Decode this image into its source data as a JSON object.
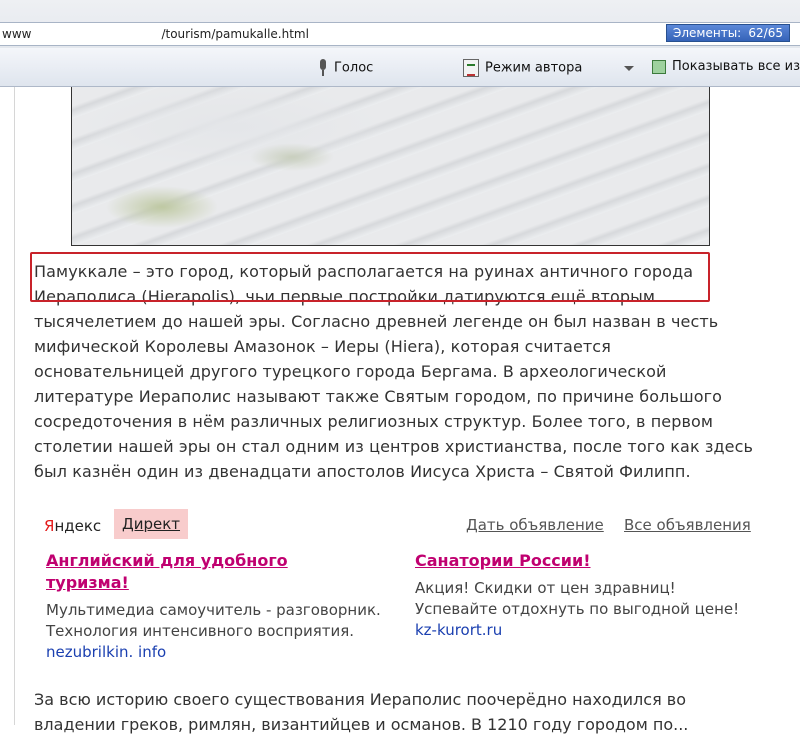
{
  "browser": {
    "url_prefix": "www",
    "url_path": "/tourism/pamukalle.html",
    "elements_label": "Элементы:",
    "elements_value": "62/65"
  },
  "toolbar": {
    "voice_label": "Голос",
    "author_mode_label": "Режим автора",
    "show_images_label": "Показывать все изоб"
  },
  "article": {
    "lines": [
      "Памуккале – это город, который располагается на руинах античного города",
      "Иераполиса (Hierapolis), чьи первые постройки датируются ещё вторым",
      "тысячелетием до нашей эры. Согласно древней легенде он был назван в честь",
      "мифической Королевы Амазонок – Иеры (Hiera), которая считается",
      "основательницей другого турецкого города Бергама. В археологической",
      "литературе Иераполис называют также Святым городом, по причине большого",
      "сосредоточения в нём различных религиозных структур. Более того, в первом",
      "столетии нашей эры он стал одним из центров христианства, после того как здесь",
      "был казнён один из двенадцати апостолов Иисуса Христа – Святой Филипп."
    ],
    "bottom_lines": [
      "За всю историю своего существования Иераполис поочерёдно находился во",
      "владении греков, римлян, византийцев и османов. В 1210 году городом по..."
    ]
  },
  "ads": {
    "yandex_y": "Я",
    "yandex_rest": "ндекс",
    "direct_label": "Директ",
    "place_ad_link": "Дать объявление",
    "all_ads_link": "Все объявления",
    "items": [
      {
        "title_line1": "Английский для удобного",
        "title_line2": "туризма!",
        "desc": "Мультимедиа самоучитель - разговорник. Технология интенсивного восприятия.",
        "url": "nezubrilkin. info"
      },
      {
        "title_line1": "Санатории России!",
        "title_line2": "",
        "desc": "Акция! Скидки от цен здравниц! Успевайте отдохнуть по выгодной цене!",
        "url": "kz-kurort.ru"
      }
    ]
  },
  "colors": {
    "highlight_border": "#c8232a",
    "ad_title": "#c00070",
    "ad_url": "#1a3fb0",
    "direct_bg": "#f8cccc"
  }
}
